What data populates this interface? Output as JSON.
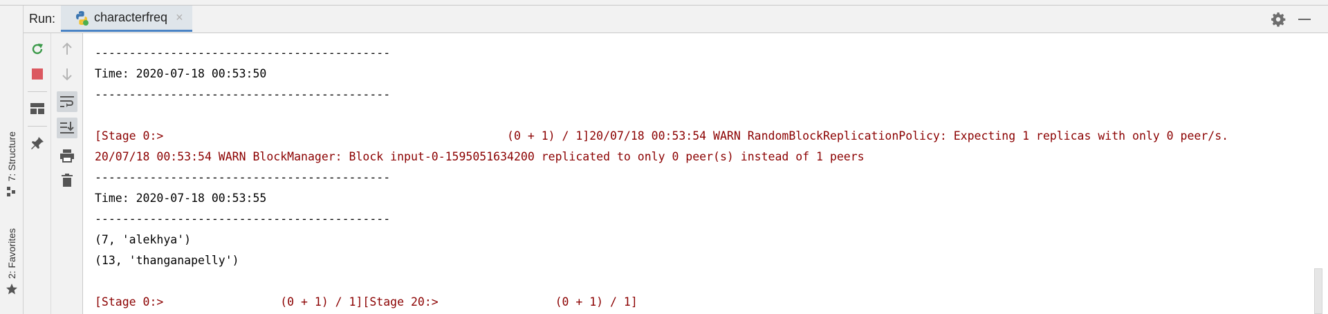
{
  "run_panel": {
    "label": "Run:",
    "tab_title": "characterfreq",
    "tab_close": "×"
  },
  "side_tabs": {
    "structure": "7: Structure",
    "favorites": "2: Favorites"
  },
  "console": {
    "lines": [
      "-------------------------------------------",
      "Time: 2020-07-18 00:53:50",
      "-------------------------------------------",
      "",
      "[Stage 0:>                                                  (0 + 1) / 1]20/07/18 00:53:54 WARN RandomBlockReplicationPolicy: Expecting 1 replicas with only 0 peer/s.",
      "20/07/18 00:53:54 WARN BlockManager: Block input-0-1595051634200 replicated to only 0 peer(s) instead of 1 peers",
      "-------------------------------------------",
      "Time: 2020-07-18 00:53:55",
      "-------------------------------------------",
      "(7, 'alekhya')",
      "(13, 'thanganapelly')",
      "",
      "[Stage 0:>                 (0 + 1) / 1][Stage 20:>                 (0 + 1) / 1]"
    ]
  },
  "colors": {
    "warn_text": "#8b0000",
    "tab_underline": "#4a83c4",
    "rerun_green": "#3c9a4a",
    "stop_red": "#db5860"
  },
  "icons": {
    "rerun": "rerun-icon",
    "stop": "stop-icon",
    "layout": "layout-icon",
    "pin": "pin-icon",
    "up": "arrow-up-icon",
    "down": "arrow-down-icon",
    "soft_wrap": "soft-wrap-icon",
    "scroll_to_end": "scroll-to-end-icon",
    "print": "print-icon",
    "clear": "trash-icon",
    "settings": "gear-icon",
    "minimize": "minimize-icon"
  }
}
